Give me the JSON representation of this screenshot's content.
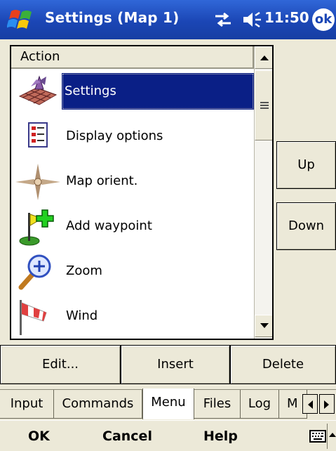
{
  "titlebar": {
    "title": "Settings (Map 1)",
    "time": "11:50",
    "ok_label": "ok",
    "icons": [
      "windows-start-icon",
      "connectivity-icon",
      "volume-icon"
    ]
  },
  "list": {
    "header": "Action",
    "items": [
      {
        "label": "Settings",
        "icon": "settings-grid-icon",
        "selected": true
      },
      {
        "label": "Display options",
        "icon": "display-options-icon",
        "selected": false
      },
      {
        "label": "Map orient.",
        "icon": "compass-rose-icon",
        "selected": false
      },
      {
        "label": "Add waypoint",
        "icon": "add-waypoint-flag-icon",
        "selected": false
      },
      {
        "label": "Zoom",
        "icon": "zoom-magnifier-icon",
        "selected": false
      },
      {
        "label": "Wind",
        "icon": "windsock-icon",
        "selected": false
      }
    ]
  },
  "side_buttons": {
    "up": "Up",
    "down": "Down"
  },
  "action_buttons": {
    "edit": "Edit...",
    "insert": "Insert",
    "delete": "Delete"
  },
  "tabs": {
    "items": [
      "Input",
      "Commands",
      "Menu",
      "Files",
      "Log",
      "M"
    ],
    "active": "Menu"
  },
  "menubar": {
    "ok": "OK",
    "cancel": "Cancel",
    "help": "Help"
  },
  "colors": {
    "titlebar": "#1b46b5",
    "selection": "#0a1f86",
    "chrome": "#ece9d8"
  }
}
